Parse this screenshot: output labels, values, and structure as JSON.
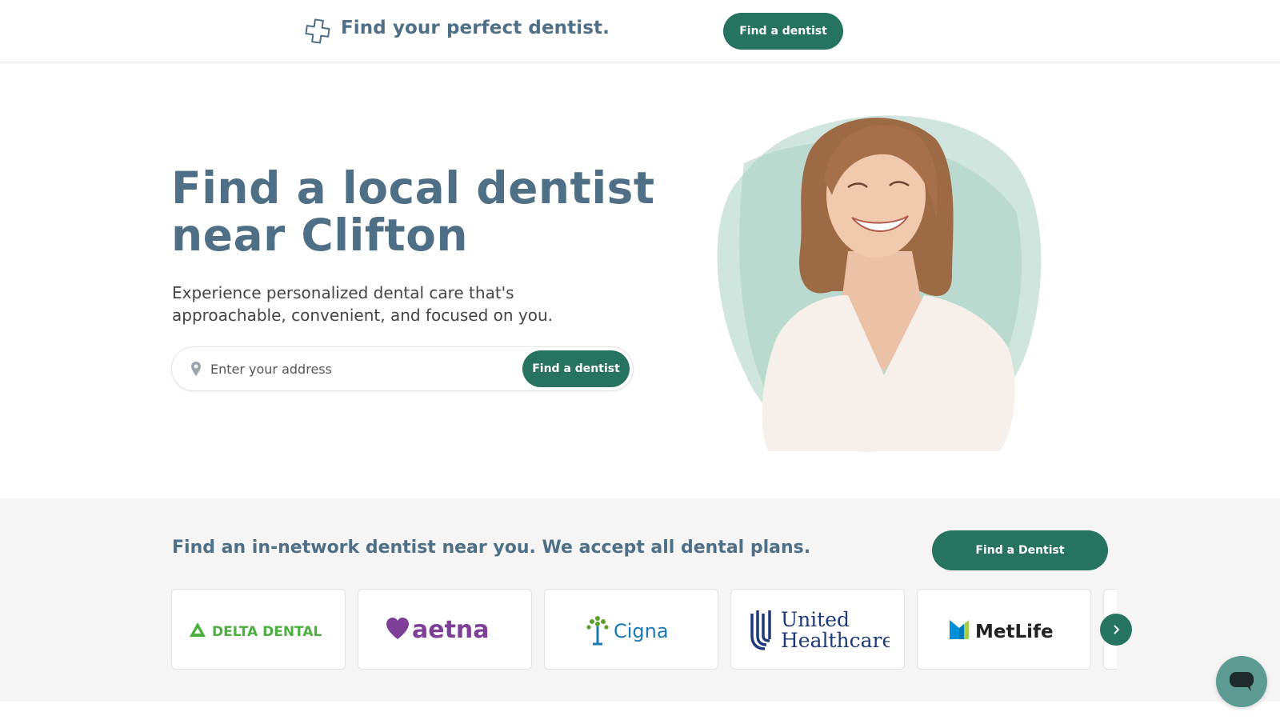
{
  "header": {
    "brand_text": "Find your perfect dentist.",
    "cta_label": "Find a dentist"
  },
  "hero": {
    "title_line1": "Find a local dentist",
    "title_line2": "near Clifton",
    "subtitle": "Experience personalized dental care that's approachable, convenient, and focused on you.",
    "search": {
      "placeholder": "Enter your address",
      "button_label": "Find a dentist"
    }
  },
  "plans": {
    "title": "Find an in-network dentist near you. We accept all dental plans.",
    "button_label": "Find a Dentist",
    "logos": [
      {
        "name": "DELTA DENTAL"
      },
      {
        "name": "aetna"
      },
      {
        "name": "Cigna"
      },
      {
        "name": "United Healthcare",
        "line1": "United",
        "line2": "Healthcare"
      },
      {
        "name": "MetLife"
      }
    ],
    "next_icon": "chevron-right-icon"
  },
  "chat": {
    "icon": "chat-bubble-icon"
  },
  "colors": {
    "brand_green": "#26735f",
    "heading_slate": "#4f6f86",
    "band_grey": "#f5f5f5",
    "photo_blob": "#cfe5de"
  }
}
